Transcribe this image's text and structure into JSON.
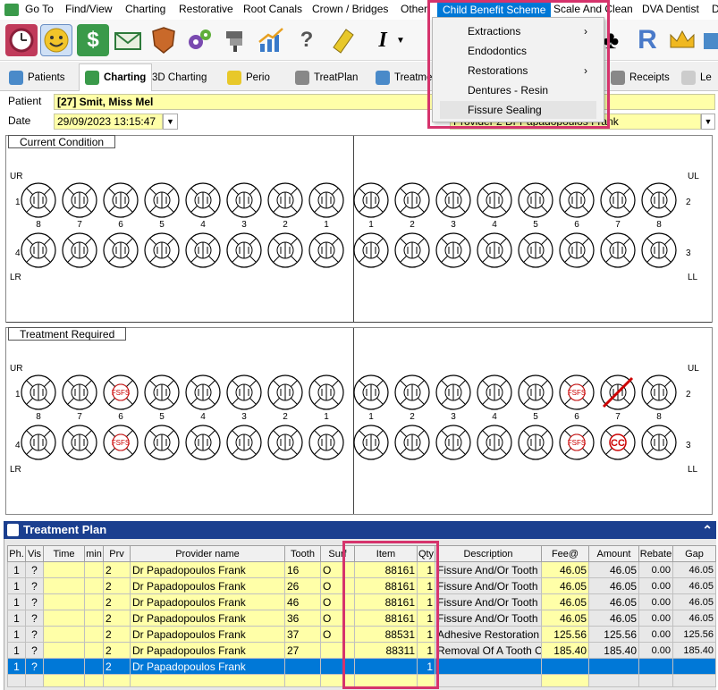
{
  "menubar": {
    "items": [
      "Go To",
      "Find/View",
      "Charting",
      "Restorative",
      "Root Canals",
      "Crown / Bridges",
      "Other",
      "Child Benefit Scheme",
      "Scale And Clean",
      "DVA Dentist",
      "D"
    ],
    "active": "Child Benefit Scheme"
  },
  "dropdown": {
    "items": [
      {
        "label": "Extractions",
        "submenu": true
      },
      {
        "label": "Endodontics",
        "submenu": false
      },
      {
        "label": "Restorations",
        "submenu": true
      },
      {
        "label": "Dentures - Resin",
        "submenu": false
      },
      {
        "label": "Fissure Sealing",
        "submenu": false
      }
    ],
    "arrow": "›"
  },
  "toolbar": {
    "icons": [
      "clock-icon",
      "smiley-icon",
      "dollar-icon",
      "envelope-icon",
      "shield-icon",
      "gears-icon",
      "dentist-chair-icon",
      "chart-icon",
      "help-icon",
      "eraser-icon",
      "text-cursor-icon",
      "dropdown-arrow-icon"
    ],
    "right_icons": [
      "club-icon",
      "r-icon",
      "crown-icon",
      "box-icon"
    ],
    "help_glyph": "?",
    "dollar_glyph": "$",
    "text_glyph": "I",
    "r_glyph": "R",
    "club_glyph": "♣"
  },
  "tabs": [
    {
      "label": "Patients"
    },
    {
      "label": "Charting",
      "active": true
    },
    {
      "label": "3D Charting"
    },
    {
      "label": "Perio"
    },
    {
      "label": "TreatPlan"
    },
    {
      "label": "Treatme"
    },
    {
      "label": "Receipts"
    },
    {
      "label": "Le"
    }
  ],
  "patient": {
    "label": "Patient",
    "value": "[27] Smit, Miss Mel",
    "date_label": "Date",
    "date_value": "29/09/2023 13:15:47",
    "provider_value": "Provider  2  Dr Papadopoulos Frank"
  },
  "current_condition": {
    "title": "Current Condition",
    "quadrants": {
      "ur": "UR",
      "ul": "UL",
      "lr": "LR",
      "ll": "LL",
      "q1": "1",
      "q2": "2",
      "q3": "3",
      "q4": "4"
    },
    "upper_numbers": [
      "8",
      "7",
      "6",
      "5",
      "4",
      "3",
      "2",
      "1",
      "1",
      "2",
      "3",
      "4",
      "5",
      "6",
      "7",
      "8"
    ]
  },
  "treatment_required": {
    "title": "Treatment Required",
    "quadrants": {
      "ur": "UR",
      "ul": "UL",
      "lr": "LR",
      "ll": "LL",
      "q1": "1",
      "q2": "2",
      "q3": "3",
      "q4": "4"
    },
    "upper_numbers": [
      "8",
      "7",
      "6",
      "5",
      "4",
      "3",
      "2",
      "1",
      "1",
      "2",
      "3",
      "4",
      "5",
      "6",
      "7",
      "8"
    ],
    "marks": {
      "fs": "FS",
      "cc": "CC"
    }
  },
  "treatment_plan": {
    "title": "Treatment Plan",
    "collapse_glyph": "⌃",
    "columns": [
      "Ph.",
      "Vis",
      "Time",
      "min",
      "Prv",
      "Provider name",
      "Tooth",
      "Surf",
      "Item",
      "Qty",
      "Description",
      "Fee@",
      "Amount",
      "Rebate",
      "Gap"
    ],
    "rows": [
      {
        "ph": "1",
        "vis": "?",
        "time": "",
        "min": "",
        "prv": "2",
        "provider": "Dr Papadopoulos Frank",
        "tooth": "16",
        "surf": "O",
        "item": "88161",
        "qty": "1",
        "desc": "Fissure And/Or Tooth",
        "fee": "46.05",
        "amount": "46.05",
        "rebate": "0.00",
        "gap": "46.05"
      },
      {
        "ph": "1",
        "vis": "?",
        "time": "",
        "min": "",
        "prv": "2",
        "provider": "Dr Papadopoulos Frank",
        "tooth": "26",
        "surf": "O",
        "item": "88161",
        "qty": "1",
        "desc": "Fissure And/Or Tooth",
        "fee": "46.05",
        "amount": "46.05",
        "rebate": "0.00",
        "gap": "46.05"
      },
      {
        "ph": "1",
        "vis": "?",
        "time": "",
        "min": "",
        "prv": "2",
        "provider": "Dr Papadopoulos Frank",
        "tooth": "46",
        "surf": "O",
        "item": "88161",
        "qty": "1",
        "desc": "Fissure And/Or Tooth",
        "fee": "46.05",
        "amount": "46.05",
        "rebate": "0.00",
        "gap": "46.05"
      },
      {
        "ph": "1",
        "vis": "?",
        "time": "",
        "min": "",
        "prv": "2",
        "provider": "Dr Papadopoulos Frank",
        "tooth": "36",
        "surf": "O",
        "item": "88161",
        "qty": "1",
        "desc": "Fissure And/Or Tooth",
        "fee": "46.05",
        "amount": "46.05",
        "rebate": "0.00",
        "gap": "46.05"
      },
      {
        "ph": "1",
        "vis": "?",
        "time": "",
        "min": "",
        "prv": "2",
        "provider": "Dr Papadopoulos Frank",
        "tooth": "37",
        "surf": "O",
        "item": "88531",
        "qty": "1",
        "desc": "Adhesive Restoration",
        "fee": "125.56",
        "amount": "125.56",
        "rebate": "0.00",
        "gap": "125.56"
      },
      {
        "ph": "1",
        "vis": "?",
        "time": "",
        "min": "",
        "prv": "2",
        "provider": "Dr Papadopoulos Frank",
        "tooth": "27",
        "surf": "",
        "item": "88311",
        "qty": "1",
        "desc": "Removal Of A Tooth O",
        "fee": "185.40",
        "amount": "185.40",
        "rebate": "0.00",
        "gap": "185.40"
      },
      {
        "ph": "1",
        "vis": "?",
        "time": "",
        "min": "",
        "prv": "2",
        "provider": "Dr Papadopoulos Frank",
        "tooth": "",
        "surf": "",
        "item": "",
        "qty": "1",
        "desc": "",
        "fee": "",
        "amount": "",
        "rebate": "",
        "gap": "",
        "selected": true
      }
    ]
  },
  "colors": {
    "menu_active": "#0078d7",
    "highlight_box": "#d6336c",
    "field_yellow": "#ffffa8",
    "tp_header": "#1b3f8f",
    "treatment_red": "#cc0000"
  }
}
